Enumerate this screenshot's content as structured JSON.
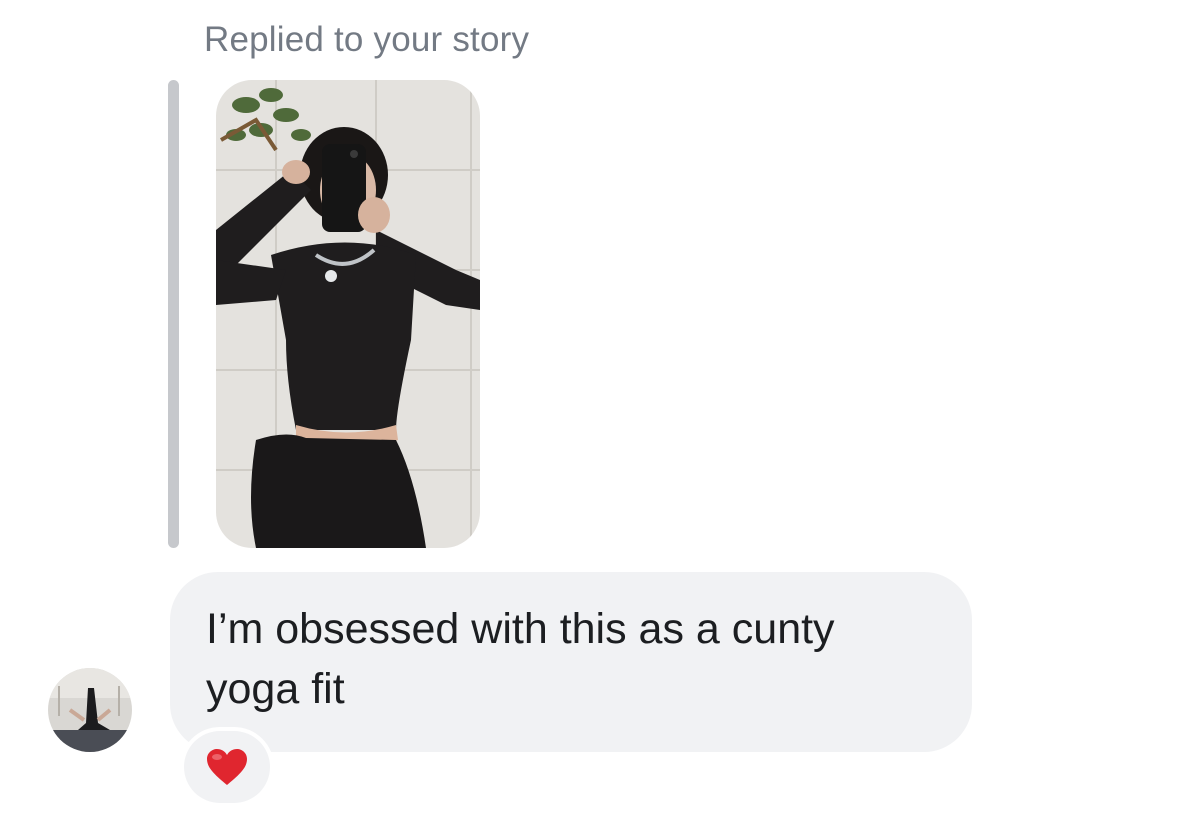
{
  "story_reply": {
    "label": "Replied to your story",
    "thumbnail_icon": "story-photo-image"
  },
  "message": {
    "text": "I’m obsessed with this as a cunty yoga fit",
    "bubble_color": "#f1f2f4",
    "text_color": "#1c1e21"
  },
  "sender": {
    "avatar_icon": "user-avatar-image"
  },
  "reaction": {
    "emoji_icon": "red-heart-icon",
    "color": "#e0262f"
  },
  "colors": {
    "label": "#737a84",
    "reply_bar": "#c6c8cc",
    "background": "#ffffff"
  }
}
